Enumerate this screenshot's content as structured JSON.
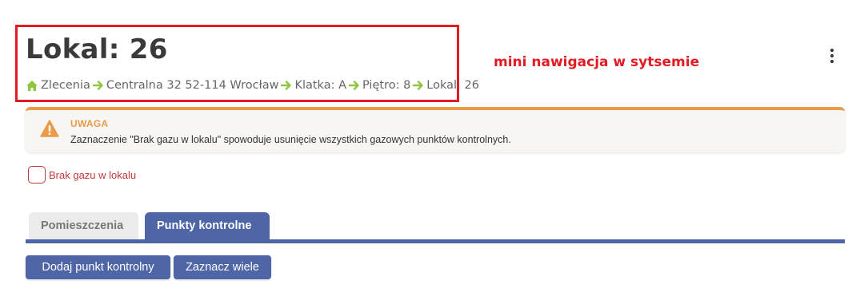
{
  "header": {
    "title": "Lokal: 26",
    "breadcrumb": [
      {
        "label": "Zlecenia",
        "icon": "home-icon"
      },
      {
        "label": "Centralna 32 52-114 Wrocław"
      },
      {
        "label": "Klatka: A"
      },
      {
        "label": "Piętro: 8"
      },
      {
        "label": "Lokal: 26"
      }
    ],
    "separator_icon": "arrow-right-icon",
    "menu_icon": "kebab-menu-icon"
  },
  "annotation": {
    "text": "mini nawigacja w sytsemie",
    "color": "#e01b24"
  },
  "alert": {
    "icon": "warning-icon",
    "title": "UWAGA",
    "message": "Zaznaczenie \"Brak gazu w lokalu\" spowoduje usunięcie wszystkich gazowych punktów kontrolnych.",
    "accent_color": "#e99b49"
  },
  "checkbox": {
    "label": "Brak gazu w lokalu",
    "checked": false,
    "color": "#c0393b"
  },
  "tabs": [
    {
      "label": "Pomieszczenia",
      "active": false
    },
    {
      "label": "Punkty kontrolne",
      "active": true
    }
  ],
  "actions": {
    "add_label": "Dodaj punkt kontrolny",
    "select_many_label": "Zaznacz wiele"
  },
  "colors": {
    "primary": "#4e65a6",
    "home_icon": "#8dc63f",
    "arrow": "#8dc63f"
  }
}
